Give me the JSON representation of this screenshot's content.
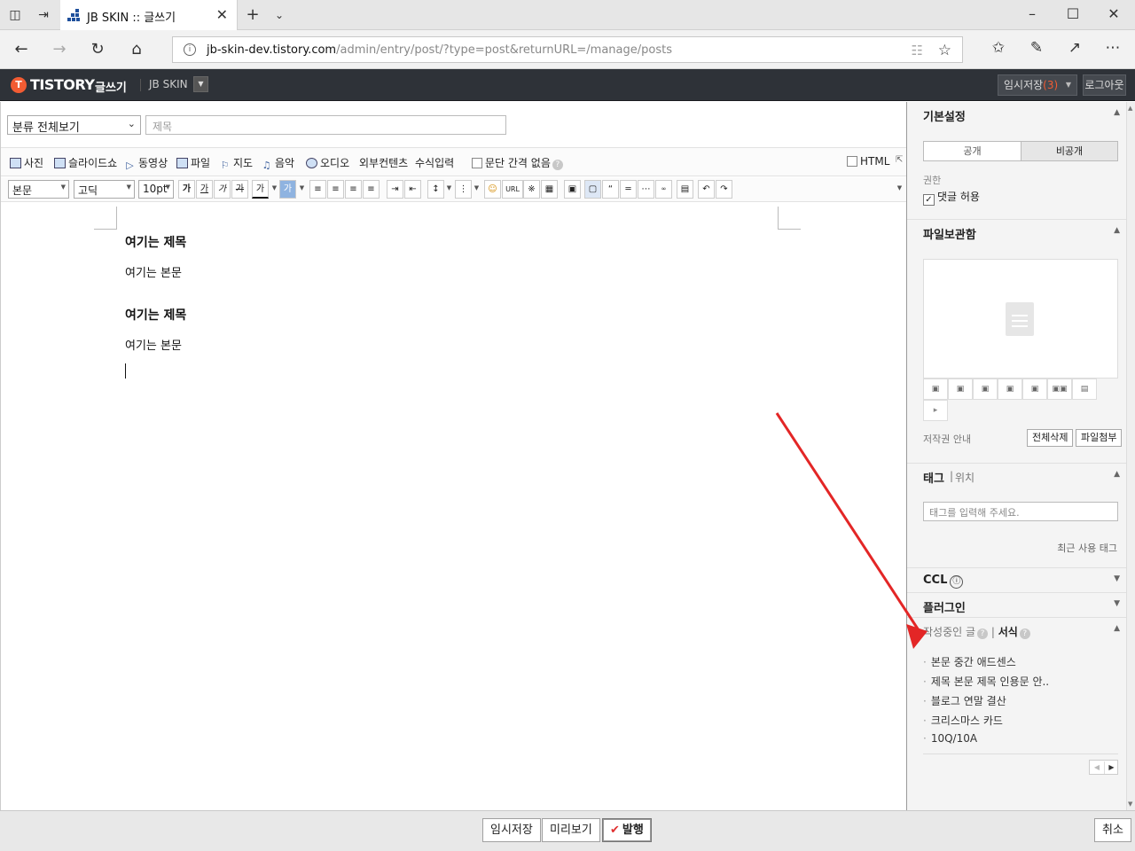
{
  "browser": {
    "tab_title": "JB SKIN :: 글쓰기",
    "url_host": "jb-skin-dev.tistory.com",
    "url_path": "/admin/entry/post/?type=post&returnURL=/manage/posts"
  },
  "header": {
    "logo_text": "TISTORY",
    "logo_mark": "T",
    "logo_sub": "글쓰기",
    "blog_name": "JB SKIN",
    "save_draft_label": "임시저장",
    "save_draft_count": "(3)",
    "logout_label": "로그아웃"
  },
  "editor": {
    "category": "분류 전체보기",
    "title_placeholder": "제목",
    "toolbar1": {
      "photo": "사진",
      "slideshow": "슬라이드쇼",
      "video": "동영상",
      "file": "파일",
      "map": "지도",
      "music": "음악",
      "audio": "오디오",
      "external": "외부컨텐츠",
      "formula": "수식입력",
      "no_spacing": "문단 간격 없음",
      "html": "HTML"
    },
    "toolbar2": {
      "style": "본문",
      "font": "고딕",
      "size": "10pt",
      "bold": "가",
      "italic": "가",
      "strike": "가",
      "underline": "가",
      "color": "가",
      "bg": "가",
      "url": "URL"
    },
    "content": [
      {
        "type": "h",
        "text": "여기는 제목"
      },
      {
        "type": "p",
        "text": "여기는 본문"
      },
      {
        "type": "h",
        "text": "여기는 제목"
      },
      {
        "type": "p",
        "text": "여기는 본문"
      }
    ]
  },
  "sidebar": {
    "basic_title": "기본설정",
    "public_label": "공개",
    "private_label": "비공개",
    "perm_label": "권한",
    "comment_label": "댓글 허용",
    "file_title": "파일보관함",
    "copyright_label": "저작권 안내",
    "delete_all_label": "전체삭제",
    "attach_label": "파일첨부",
    "tag_title": "태그",
    "location_label": "위치",
    "tag_placeholder": "태그를 입력해 주세요.",
    "recent_tags_label": "최근 사용 태그",
    "ccl_title": "CCL",
    "plugin_title": "플러그인",
    "writing_label": "작성중인 글",
    "template_label": "서식",
    "templates": [
      "본문 중간 애드센스",
      "제목 본문 제목 인용문 안..",
      "블로그 연말 결산",
      "크리스마스 카드",
      "10Q/10A"
    ]
  },
  "footer": {
    "draft_label": "임시저장",
    "preview_label": "미리보기",
    "publish_label": "발행",
    "cancel_label": "취소"
  },
  "colors": {
    "header_bg": "#2e3238",
    "logo_accent": "#f25c33",
    "annotation": "#e32626"
  }
}
